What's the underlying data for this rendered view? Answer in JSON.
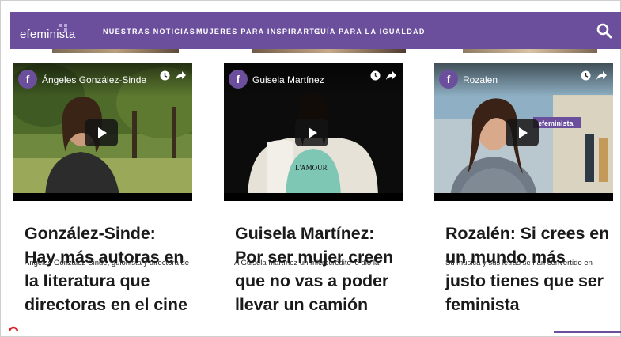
{
  "header": {
    "logo_text": "efeminista",
    "nav": [
      {
        "label": "NUESTRAS NOTICIAS"
      },
      {
        "label": "MUJERES PARA INSPIRARTE"
      },
      {
        "label": "GUÍA PARA LA IGUALDAD"
      }
    ],
    "search_icon": "search-icon"
  },
  "colors": {
    "brand_purple": "#6b4f9c",
    "headline_text": "#1a1a1a"
  },
  "cards": [
    {
      "channel_letter": "f",
      "video_name": "Ángeles González-Sinde",
      "headline": "González-Sinde: Hay más autoras en la literatura que directoras en el cine",
      "excerpt": "Ángeles González-Sinde, guionista y directora de"
    },
    {
      "channel_letter": "f",
      "video_name": "Guisela Martínez",
      "headline": "Guisela Martínez: Por ser mujer creen que no vas a poder llevar un camión",
      "excerpt": "A Guisela Martínez un microcrédito le dio la"
    },
    {
      "channel_letter": "f",
      "video_name": "Rozalen",
      "headline": "Rozalén: Si crees en un mundo más justo tienes que ser feminista",
      "excerpt": "Su música y sus letras se han convertido en",
      "banner_text": "efeminista"
    }
  ]
}
